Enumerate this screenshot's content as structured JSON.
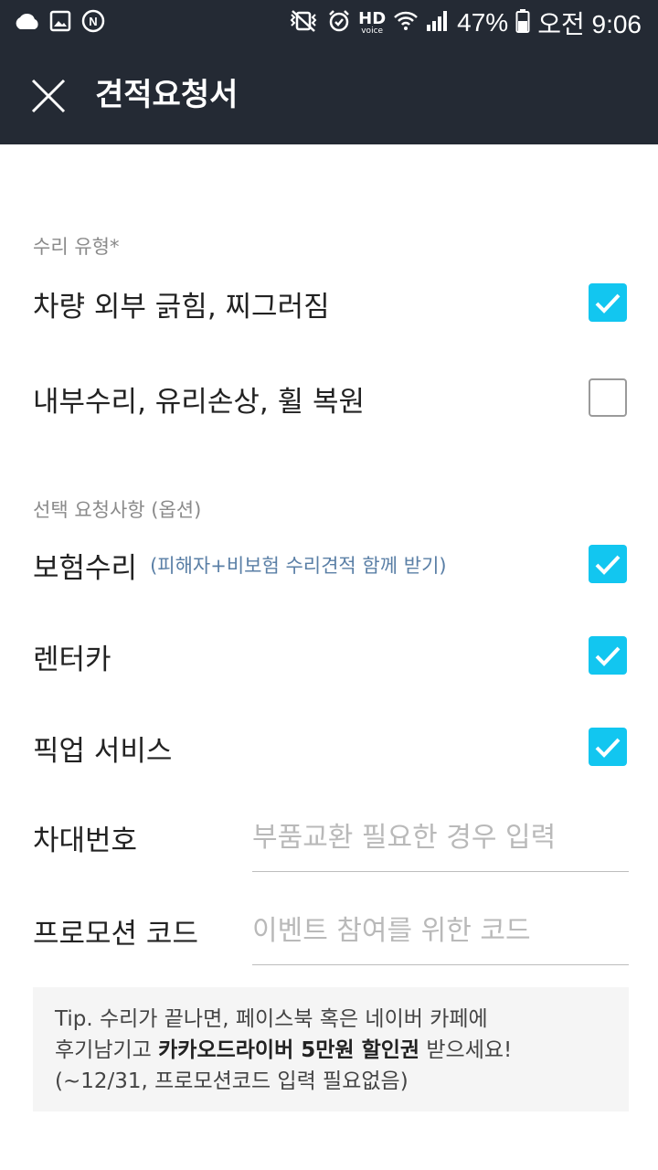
{
  "status_bar": {
    "battery": "47%",
    "time": "오전 9:06",
    "hd_top": "HD",
    "hd_bottom": "voice",
    "left_icons": [
      "cloud-icon",
      "image-icon",
      "n-sync-icon"
    ],
    "right_icons": [
      "vibrate-mute-icon",
      "alarm-icon",
      "wifi-icon",
      "signal-icon",
      "battery-icon"
    ]
  },
  "app_bar": {
    "title": "견적요청서",
    "close_icon": "close-icon"
  },
  "repair_type": {
    "label": "수리 유형*",
    "options": [
      {
        "label": "차량 외부 긁힘, 찌그러짐",
        "checked": true
      },
      {
        "label": "내부수리, 유리손상, 휠 복원",
        "checked": false
      }
    ]
  },
  "optional_requests": {
    "label": "선택 요청사항 (옵션)",
    "options": [
      {
        "label": "보험수리",
        "sub": "(피해자+비보험 수리견적 함께 받기)",
        "checked": true
      },
      {
        "label": "렌터카",
        "checked": true
      },
      {
        "label": "픽업 서비스",
        "checked": true
      }
    ]
  },
  "fields": {
    "vin": {
      "label": "차대번호",
      "placeholder": "부품교환 필요한 경우 입력",
      "value": ""
    },
    "promo": {
      "label": "프로모션 코드",
      "placeholder": "이벤트 참여를 위한 코드",
      "value": ""
    }
  },
  "tip": {
    "line1": "Tip. 수리가 끝나면, 페이스북 혹은 네이버 카페에",
    "line2_a": "후기남기고 ",
    "line2_bold": "카카오드라이버 5만원 할인권",
    "line2_b": " 받으세요!",
    "line3": "(~12/31, 프로모션코드 입력 필요없음)"
  },
  "colors": {
    "header_bg": "#242a34",
    "checkbox_on": "#12c6f0",
    "sub_text": "#5a7fa6"
  }
}
